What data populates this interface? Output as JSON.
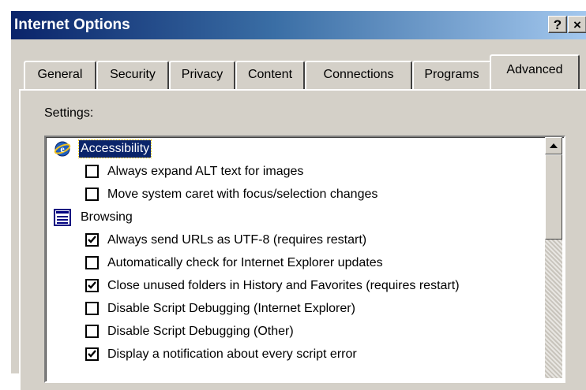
{
  "window": {
    "title": "Internet Options",
    "help_label": "?",
    "close_label": "×"
  },
  "tabs": [
    {
      "label": "General",
      "active": false
    },
    {
      "label": "Security",
      "active": false
    },
    {
      "label": "Privacy",
      "active": false
    },
    {
      "label": "Content",
      "active": false
    },
    {
      "label": "Connections",
      "active": false
    },
    {
      "label": "Programs",
      "active": false
    },
    {
      "label": "Advanced",
      "active": true
    }
  ],
  "settings": {
    "label": "Settings:",
    "categories": [
      {
        "label": "Accessibility",
        "icon": "accessibility-icon",
        "selected": true,
        "options": [
          {
            "label": "Always expand ALT text for images",
            "checked": false
          },
          {
            "label": "Move system caret with focus/selection changes",
            "checked": false
          }
        ]
      },
      {
        "label": "Browsing",
        "icon": "browsing-icon",
        "selected": false,
        "options": [
          {
            "label": "Always send URLs as UTF-8 (requires restart)",
            "checked": true
          },
          {
            "label": "Automatically check for Internet Explorer updates",
            "checked": false
          },
          {
            "label": "Close unused folders in History and Favorites (requires restart)",
            "checked": true
          },
          {
            "label": "Disable Script Debugging (Internet Explorer)",
            "checked": false
          },
          {
            "label": "Disable Script Debugging (Other)",
            "checked": false
          },
          {
            "label": "Display a notification about every script error",
            "checked": true
          }
        ]
      }
    ]
  },
  "colors": {
    "titlebar_start": "#0a246a",
    "titlebar_end": "#a6caf0",
    "face": "#d4d0c8",
    "selection": "#0a246a"
  }
}
